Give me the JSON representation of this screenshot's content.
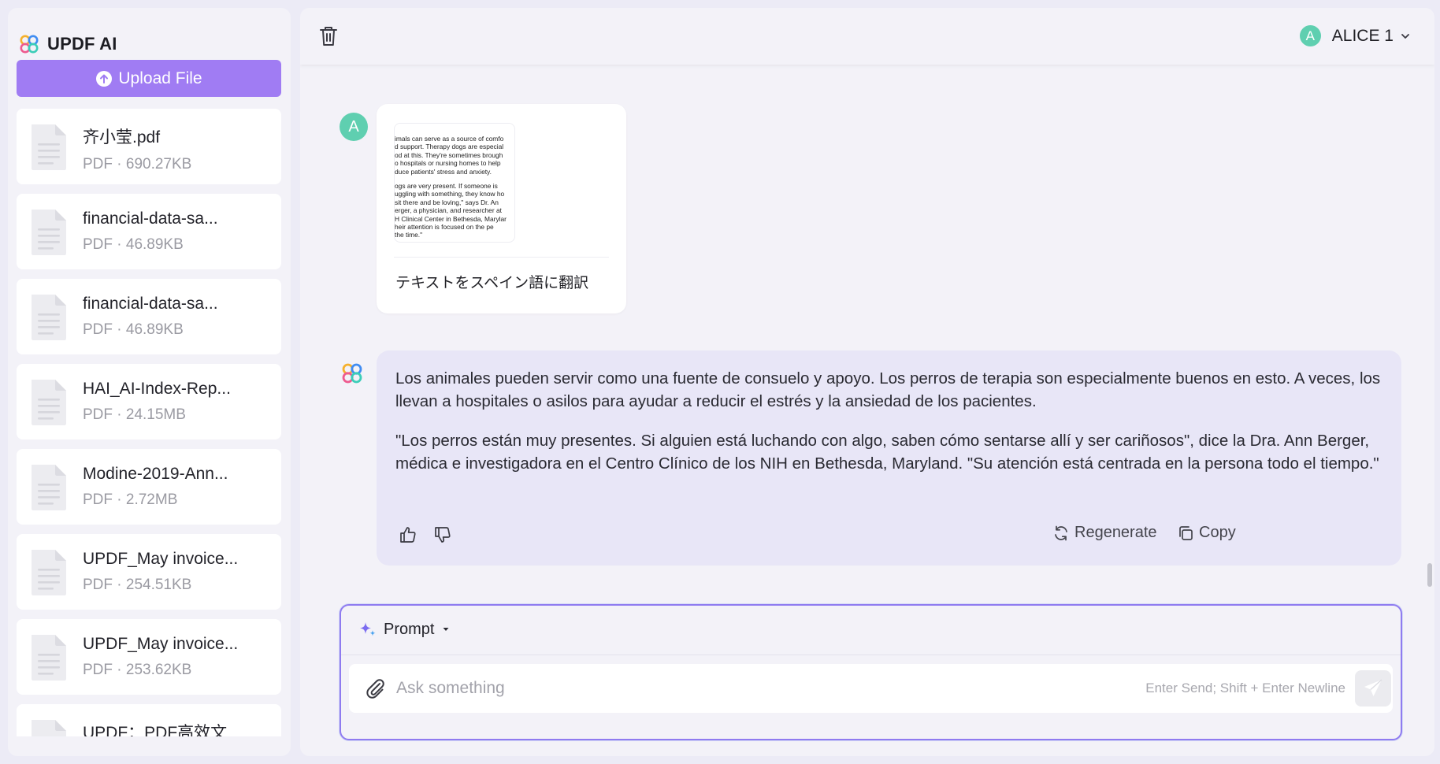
{
  "sidebar": {
    "brand": "UPDF AI",
    "upload_label": "Upload File",
    "files": [
      {
        "name": "齐小莹.pdf",
        "meta": "PDF · 690.27KB"
      },
      {
        "name": "financial-data-sa...",
        "meta": "PDF · 46.89KB"
      },
      {
        "name": "financial-data-sa...",
        "meta": "PDF · 46.89KB"
      },
      {
        "name": "HAI_AI-Index-Rep...",
        "meta": "PDF · 24.15MB"
      },
      {
        "name": "Modine-2019-Ann...",
        "meta": "PDF · 2.72MB"
      },
      {
        "name": "UPDF_May invoice...",
        "meta": "PDF · 254.51KB"
      },
      {
        "name": "UPDF_May invoice...",
        "meta": "PDF · 253.62KB"
      },
      {
        "name": "UPDF：PDF高效文",
        "meta": ""
      }
    ]
  },
  "header": {
    "user_initial": "A",
    "user_name": "ALICE 1"
  },
  "conversation": {
    "user_message": {
      "avatar_initial": "A",
      "thumbnail_lines_p1": [
        "imals can serve as a source of comfo",
        "d support. Therapy dogs are especial",
        "od at this. They're sometimes brough",
        "o hospitals or nursing homes to help",
        "duce patients' stress and anxiety."
      ],
      "thumbnail_lines_p2": [
        "ogs are very present. If someone is",
        "uggling with something, they know ho",
        "sit there and be loving,\" says Dr. An",
        "erger, a physician, and researcher at",
        "H Clinical Center in Bethesda, Marylar",
        "heir attention is focused on the pe",
        "the time.\""
      ],
      "text": "テキストをスペイン語に翻訳"
    },
    "ai_message": {
      "paragraph_1": "Los animales pueden servir como una fuente de consuelo y apoyo. Los perros de terapia son especialmente buenos en esto. A veces, los llevan a hospitales o asilos para ayudar a reducir el estrés y la ansiedad de los pacientes.",
      "paragraph_2": "\"Los perros están muy presentes. Si alguien está luchando con algo, saben cómo sentarse allí y ser cariñosos\", dice la Dra. Ann Berger, médica e investigadora en el Centro Clínico de los NIH en Bethesda, Maryland. \"Su atención está centrada en la persona todo el tiempo.\"",
      "regenerate_label": "Regenerate",
      "copy_label": "Copy"
    }
  },
  "composer": {
    "prompt_label": "Prompt",
    "placeholder": "Ask something",
    "value": "",
    "hint": "Enter Send; Shift + Enter Newline"
  },
  "colors": {
    "accent": "#a07cf3",
    "ai_bubble": "#e8e6f7",
    "avatar": "#5fcfb0",
    "input_border": "#8f7bf0"
  }
}
